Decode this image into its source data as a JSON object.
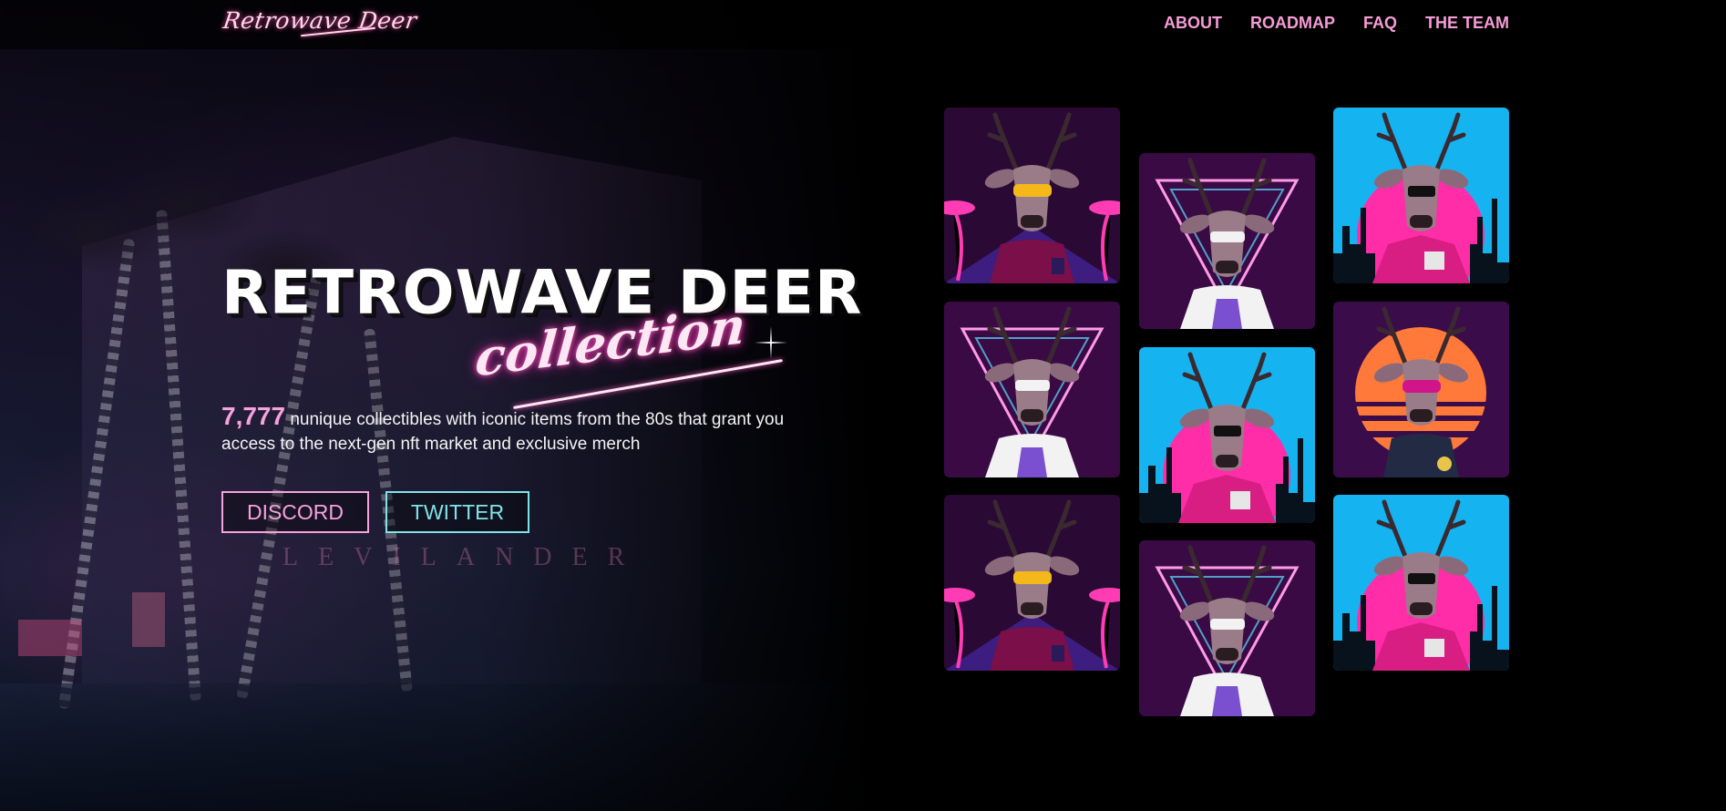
{
  "header": {
    "logo_text": "Retrowave Deer",
    "nav": [
      {
        "label": "ABOUT"
      },
      {
        "label": "ROADMAP"
      },
      {
        "label": "FAQ"
      },
      {
        "label": "THE TEAM"
      }
    ]
  },
  "hero": {
    "title_main": "RETROWAVE DEER",
    "title_script": "collection",
    "count": "7,777",
    "description": "nunique collectibles with iconic items from the 80s that grant you access to the next-gen nft market and exclusive merch",
    "background_sign": "LEVILANDER"
  },
  "buttons": {
    "discord": "DISCORD",
    "twitter": "TWITTER"
  },
  "gallery": [
    {
      "variant": "palm-vr",
      "bg": "#2a0a35",
      "accent": "#ff3cb4"
    },
    {
      "variant": "triangle-fur",
      "bg": "#3a0a45",
      "accent": "#ff5ad0"
    },
    {
      "variant": "skyline-sun",
      "bg": "#15b4f0",
      "accent": "#ff2da8"
    },
    {
      "variant": "triangle-fur",
      "bg": "#3a0a45",
      "accent": "#ff5ad0"
    },
    {
      "variant": "skyline-sun",
      "bg": "#15b4f0",
      "accent": "#ff2da8"
    },
    {
      "variant": "sunset-shades",
      "bg": "#3b0c4a",
      "accent": "#ff7a3a"
    },
    {
      "variant": "palm-vr",
      "bg": "#2a0a35",
      "accent": "#ff3cb4"
    },
    {
      "variant": "triangle-fur",
      "bg": "#3a0a45",
      "accent": "#ff5ad0"
    },
    {
      "variant": "skyline-sun",
      "bg": "#15b4f0",
      "accent": "#ff2da8"
    }
  ],
  "colors": {
    "pink": "#f7a1dd",
    "cyan": "#7fe3e8",
    "nav": "#f59cd6"
  }
}
